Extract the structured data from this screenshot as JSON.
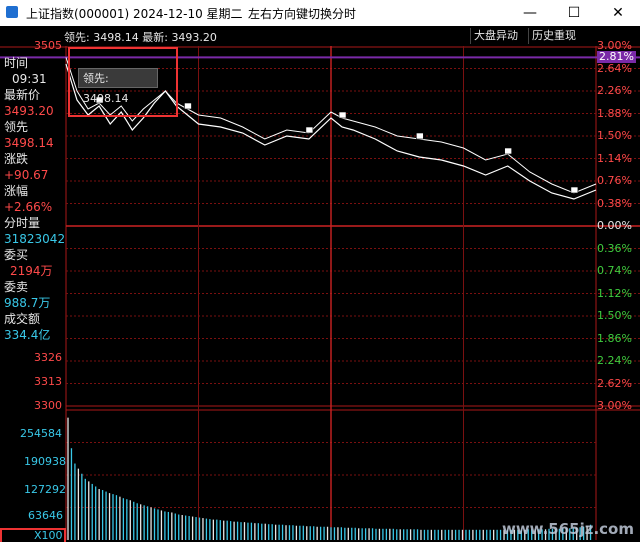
{
  "window": {
    "title": "上证指数(000001) 2024-12-10 星期二",
    "hint": "左右方向键切换分时",
    "min_icon": "minimize-icon",
    "max_icon": "maximize-icon",
    "close_icon": "close-icon"
  },
  "toolbar": {
    "lead_label": "领先:",
    "lead_value": "3498.14",
    "latest_label": "最新:",
    "latest_value": "3493.20",
    "btn_market": "大盘异动",
    "btn_replay": "历史重现"
  },
  "tooltip": {
    "label": "领先:",
    "value": "3498.14"
  },
  "info_panel": {
    "time_label": "时间",
    "time_value": "09:31",
    "last_label": "最新价",
    "last_value": "3493.20",
    "lead_label": "领先",
    "lead_value": "3498.14",
    "change_label": "涨跌",
    "change_value": "+90.67",
    "pct_label": "涨幅",
    "pct_value": "+2.66%",
    "vol_label": "分时量",
    "vol_value": "31823042",
    "buy_label": "委买",
    "buy_value": "2194万",
    "sell_label": "委卖",
    "sell_value": "988.7万",
    "amount_label": "成交额",
    "amount_value": "334.4亿"
  },
  "price_axis": {
    "top": "3505",
    "l1": "3326",
    "l2": "3313",
    "bottom": "3300"
  },
  "pct_axis": [
    "3.00%",
    "2.81%",
    "2.64%",
    "2.26%",
    "1.88%",
    "1.50%",
    "1.14%",
    "0.76%",
    "0.38%",
    "0.00%",
    "0.36%",
    "0.74%",
    "1.12%",
    "1.50%",
    "1.86%",
    "2.24%",
    "2.62%",
    "3.00%"
  ],
  "volume_axis": [
    "254584",
    "190938",
    "127292",
    "63646",
    "X100"
  ],
  "watermark": "www.565jz.com",
  "colors": {
    "up": "#ff4a4a",
    "grid": "#7a1010",
    "line": "#ffffff",
    "volume": "#39c8e8",
    "panel_text": "#e8e8e8"
  },
  "chart_data": {
    "type": "line",
    "title": "",
    "xlabel": "",
    "ylabel": "",
    "x_range_minutes": [
      0,
      240
    ],
    "y_pct_range": [
      -3.0,
      3.0
    ],
    "series": [
      {
        "name": "最新",
        "x": [
          0,
          5,
          10,
          15,
          20,
          25,
          30,
          35,
          40,
          45,
          50,
          55,
          60,
          70,
          80,
          90,
          100,
          110,
          120,
          125,
          130,
          140,
          150,
          160,
          170,
          180,
          190,
          200,
          210,
          220,
          230,
          240
        ],
        "pct": [
          2.7,
          2.1,
          1.85,
          2.0,
          1.7,
          1.9,
          1.6,
          1.8,
          2.05,
          2.25,
          2.0,
          1.85,
          1.7,
          1.65,
          1.55,
          1.35,
          1.5,
          1.45,
          1.8,
          1.65,
          1.6,
          1.45,
          1.25,
          1.15,
          1.1,
          1.0,
          0.85,
          1.0,
          0.75,
          0.55,
          0.45,
          0.6
        ]
      },
      {
        "name": "领先",
        "x": [
          0,
          5,
          10,
          15,
          20,
          25,
          30,
          35,
          40,
          45,
          50,
          55,
          60,
          70,
          80,
          90,
          100,
          110,
          120,
          125,
          130,
          140,
          150,
          160,
          170,
          180,
          190,
          200,
          210,
          220,
          230,
          240
        ],
        "pct": [
          2.81,
          2.25,
          1.95,
          2.05,
          1.85,
          2.0,
          1.75,
          1.95,
          2.1,
          2.25,
          2.05,
          1.95,
          1.85,
          1.8,
          1.65,
          1.45,
          1.6,
          1.55,
          1.9,
          1.8,
          1.75,
          1.65,
          1.5,
          1.45,
          1.4,
          1.3,
          1.1,
          1.2,
          0.9,
          0.7,
          0.55,
          0.7
        ]
      }
    ],
    "volume": [
      240,
      180,
      150,
      140,
      130,
      120,
      115,
      110,
      105,
      100,
      98,
      95,
      92,
      90,
      88,
      85,
      82,
      80,
      78,
      75,
      72,
      70,
      68,
      66,
      64,
      62,
      60,
      58,
      56,
      55,
      54,
      52,
      50,
      49,
      48,
      47,
      46,
      45,
      44,
      43,
      42,
      41,
      40,
      40,
      39,
      38,
      38,
      37,
      36,
      36,
      35,
      35,
      34,
      34,
      33,
      33,
      32,
      32,
      31,
      31,
      30,
      30,
      30,
      29,
      29,
      29,
      28,
      28,
      28,
      27,
      27,
      27,
      26,
      26,
      26,
      26,
      25,
      25,
      25,
      25,
      24,
      24,
      24,
      24,
      23,
      23,
      23,
      23,
      23,
      22,
      22,
      22,
      22,
      22,
      22,
      21,
      21,
      21,
      21,
      21,
      21,
      21,
      20,
      20,
      20,
      20,
      20,
      20,
      20,
      20,
      20,
      20,
      20,
      20,
      20,
      20,
      20,
      20,
      20,
      20,
      20,
      20,
      20,
      20,
      20,
      20,
      20,
      20,
      20,
      20,
      20,
      20,
      20,
      21,
      21,
      21,
      21,
      21,
      21,
      22,
      22,
      22,
      22,
      23,
      23,
      23,
      24,
      24,
      25,
      26,
      28,
      30
    ]
  }
}
